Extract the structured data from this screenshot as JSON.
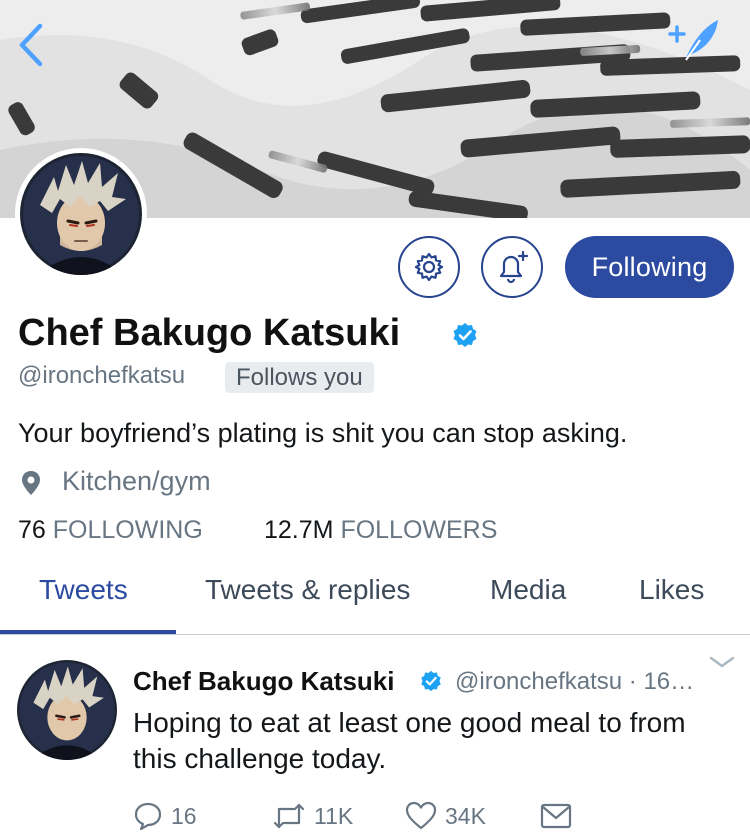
{
  "header": {
    "back_icon": "chevron-left-icon",
    "compose_icon": "compose-feather-icon",
    "accent_color": "#4da1ff"
  },
  "profile": {
    "display_name": "Chef Bakugo Katsuki",
    "handle": "@ironchefkatsu",
    "follows_you": "Follows you",
    "bio": "Your boyfriend’s plating is shit you can stop asking.",
    "location": "Kitchen/gym",
    "following_count": "76",
    "following_label": "FOLLOWING",
    "followers_count": "12.7M",
    "followers_label": "FOLLOWERS",
    "verified": true
  },
  "actions": {
    "settings_icon": "gear-icon",
    "notify_icon": "bell-plus-icon",
    "follow_label": "Following"
  },
  "tabs": [
    {
      "label": "Tweets",
      "active": true
    },
    {
      "label": "Tweets & replies",
      "active": false
    },
    {
      "label": "Media",
      "active": false
    },
    {
      "label": "Likes",
      "active": false
    }
  ],
  "tweet": {
    "name": "Chef Bakugo Katsuki",
    "meta": "@ironchefkatsu · 16…",
    "text": "Hoping to eat at least one good meal to from this challenge today.",
    "replies": "16",
    "retweets": "11K",
    "likes": "34K"
  },
  "colors": {
    "brand": "#2b4aa0",
    "muted": "#687683",
    "verified": "#1da1f2"
  }
}
